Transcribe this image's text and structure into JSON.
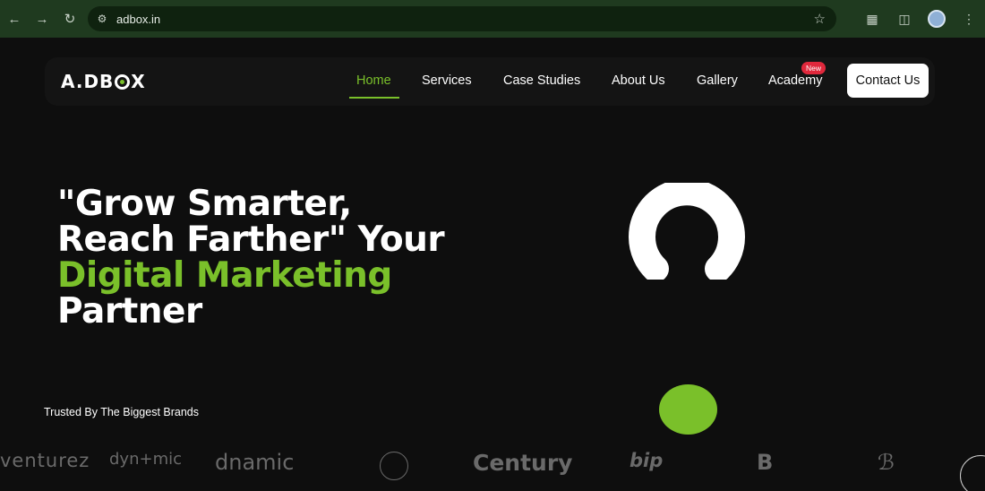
{
  "browser": {
    "url": "adbox.in",
    "icons": {
      "back": "arrow-left-icon",
      "forward": "arrow-right-icon",
      "reload": "reload-icon",
      "site_info": "tune-icon",
      "bookmark": "star-icon",
      "extensions": "puzzle-icon",
      "cast": "cast-icon",
      "profile": "avatar",
      "menu": "kebab-menu-icon"
    }
  },
  "site": {
    "logo": "ADBOX",
    "nav": {
      "items": [
        "Home",
        "Services",
        "Case Studies",
        "About Us",
        "Gallery",
        "Academy"
      ],
      "active": "Home",
      "badge": "New",
      "cta": "Contact Us"
    },
    "hero": {
      "line1": "\"Grow Smarter,",
      "line2": "Reach Farther\" Your",
      "line3": "Digital Marketing",
      "line4": "Partner"
    },
    "trusted_heading": "Trusted By The Biggest Brands",
    "brands": [
      "venturez",
      "dyn+mic",
      "dnamic",
      "Century",
      "bip",
      "B"
    ]
  },
  "colors": {
    "accent": "#7ac02a",
    "badge": "#e0283c",
    "chrome": "#1f3a1f",
    "background": "#0e0e0e"
  }
}
